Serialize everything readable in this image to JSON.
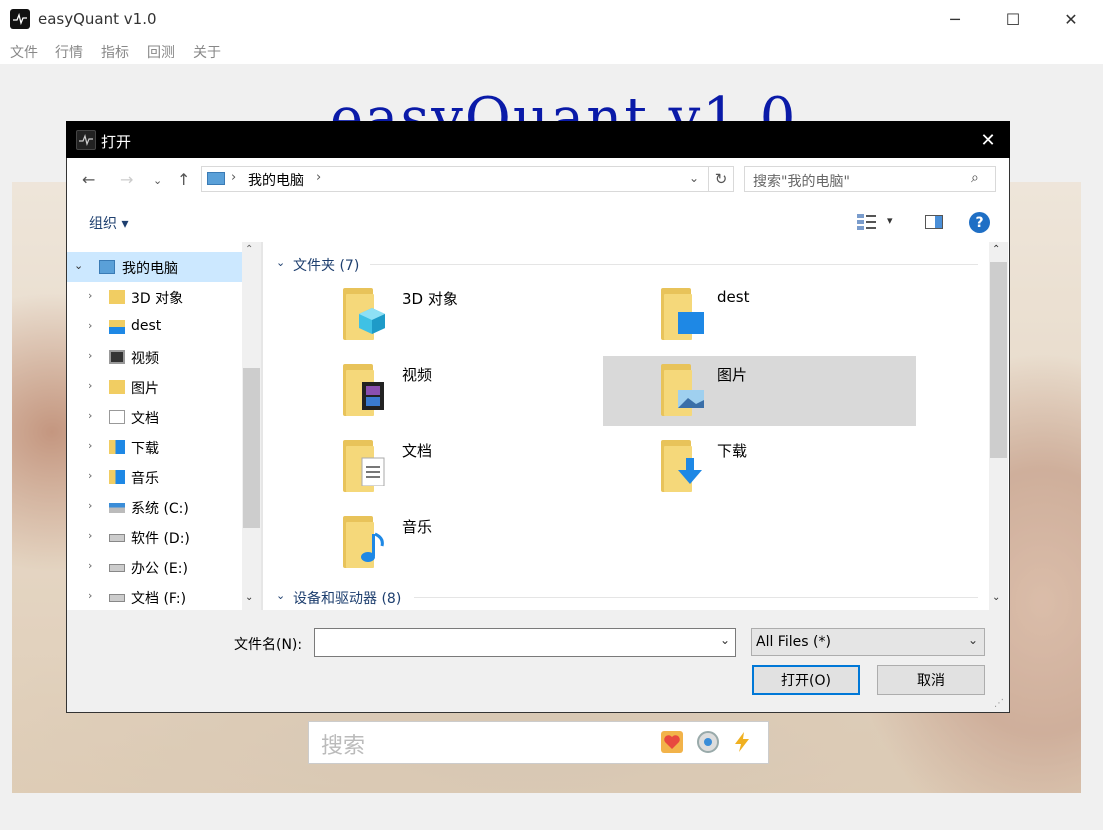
{
  "app": {
    "title": "easyQuant v1.0",
    "heading": "easyQuant v1.0",
    "window_controls": [
      "─",
      "☐",
      "✕"
    ]
  },
  "menu": [
    "文件",
    "行情",
    "指标",
    "回测",
    "关于"
  ],
  "search": {
    "placeholder": "搜索"
  },
  "dialog": {
    "title": "打开",
    "close": "✕",
    "address": "我的电脑",
    "search_placeholder": "搜索\"我的电脑\"",
    "organize": "组织 ▾",
    "help": "?",
    "nav_items": [
      {
        "label": "我的电脑",
        "expanded": true,
        "icon": "computer-icon"
      },
      {
        "label": "3D 对象",
        "icon": "folder-3d-icon"
      },
      {
        "label": "dest",
        "icon": "folder-icon"
      },
      {
        "label": "视频",
        "icon": "video-folder-icon"
      },
      {
        "label": "图片",
        "icon": "pictures-folder-icon"
      },
      {
        "label": "文档",
        "icon": "documents-folder-icon"
      },
      {
        "label": "下载",
        "icon": "downloads-folder-icon"
      },
      {
        "label": "音乐",
        "icon": "music-folder-icon"
      },
      {
        "label": "系统 (C:)",
        "icon": "system-drive-icon"
      },
      {
        "label": "软件 (D:)",
        "icon": "drive-icon"
      },
      {
        "label": "办公 (E:)",
        "icon": "drive-icon"
      },
      {
        "label": "文档 (F:)",
        "icon": "drive-icon"
      }
    ],
    "groups": [
      {
        "label": "文件夹 (7)"
      },
      {
        "label": "设备和驱动器 (8)"
      }
    ],
    "folders": [
      {
        "label": "3D 对象",
        "badge": "cube"
      },
      {
        "label": "dest",
        "badge": "blue-square"
      },
      {
        "label": "视频",
        "badge": "film"
      },
      {
        "label": "图片",
        "badge": "landscape",
        "selected": true
      },
      {
        "label": "文档",
        "badge": "document"
      },
      {
        "label": "下载",
        "badge": "arrow-down"
      },
      {
        "label": "音乐",
        "badge": "note"
      }
    ],
    "filename_label": "文件名(N):",
    "filename_value": "",
    "filter": "All Files  (*)",
    "open_button": "打开(O)",
    "cancel_button": "取消"
  },
  "colors": {
    "accent": "#0078d7",
    "heading": "#0a1aa8",
    "selection": "#d9d9d9"
  }
}
